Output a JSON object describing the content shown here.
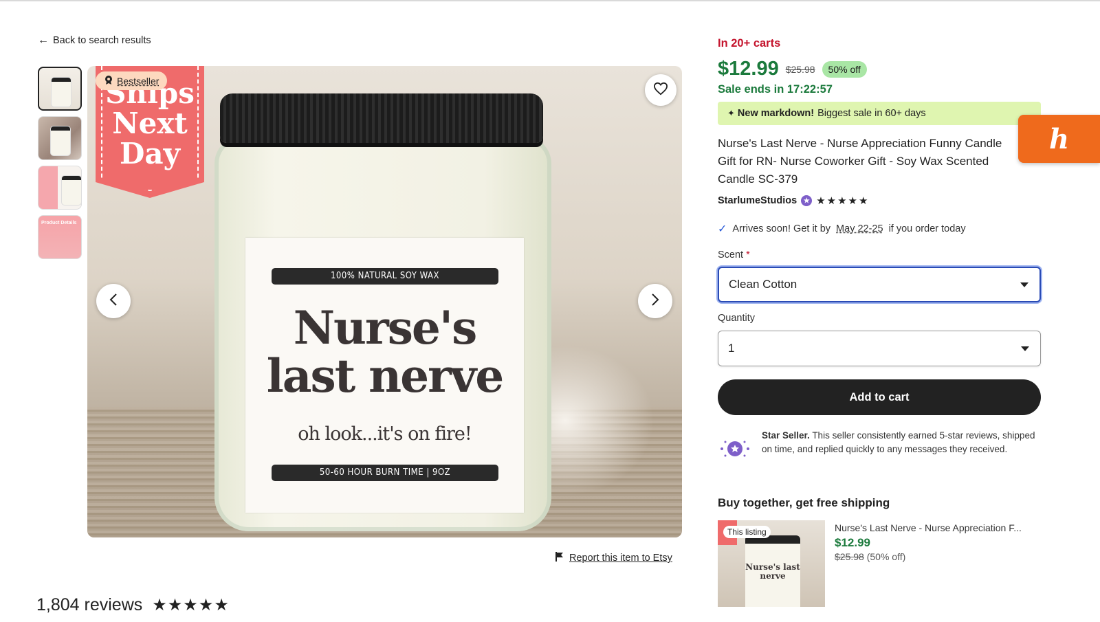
{
  "nav": {
    "back_label": "Back to search results"
  },
  "gallery": {
    "bestseller_label": "Bestseller",
    "ribbon_text_1": "Ships",
    "ribbon_text_2": "Next",
    "ribbon_text_3": "Day",
    "jar_band_top": "100% NATURAL SOY WAX",
    "jar_line_1": "Nurse's",
    "jar_line_2": "last nerve",
    "jar_line_3": "oh look...it's on fire!",
    "jar_band_bottom": "50-60 HOUR BURN TIME  |  9OZ",
    "thumb_4_label": "Product Details",
    "icons": [
      "heart-icon",
      "chevron-left-icon",
      "chevron-right-icon"
    ]
  },
  "report_label": "Report this item to Etsy",
  "reviews": {
    "count_label": "1,804 reviews",
    "stars": "★★★★★"
  },
  "product": {
    "in_carts": "In 20+ carts",
    "price": "$12.99",
    "original_price": "$25.98",
    "discount": "50% off",
    "sale_ends": "Sale ends in 17:22:57",
    "markdown_bold": "New markdown!",
    "markdown_rest": "Biggest sale in 60+ days",
    "title": "Nurse's Last Nerve - Nurse Appreciation Funny Candle Gift for RN- Nurse Coworker Gift - Soy Wax Scented Candle SC-379",
    "seller_name": "StarlumeStudios",
    "seller_stars": "★★★★★",
    "arrives_pre": "Arrives soon! Get it by",
    "arrives_date": "May 22-25",
    "arrives_post": "if you order today",
    "scent_label": "Scent",
    "scent_required": "*",
    "scent_value": "Clean Cotton",
    "quantity_label": "Quantity",
    "quantity_value": "1",
    "add_to_cart": "Add to cart",
    "star_seller_bold": "Star Seller.",
    "star_seller_text": "This seller consistently earned 5-star reviews, shipped on time, and replied quickly to any messages they received."
  },
  "bundle": {
    "title": "Buy together, get free shipping",
    "tag": "This listing",
    "jar_text": "Nurse's last nerve",
    "name": "Nurse's Last Nerve - Nurse Appreciation F...",
    "price": "$12.99",
    "original_price": "$25.98",
    "discount_note": "(50% off)"
  },
  "honey": {
    "glyph": "h"
  },
  "colors": {
    "price_green": "#1b7a3c",
    "cart_red": "#c4132c",
    "markdown_bg": "#dff5b0",
    "accent_blue": "#2a4bb5",
    "honey_orange": "#ef6a1c"
  }
}
